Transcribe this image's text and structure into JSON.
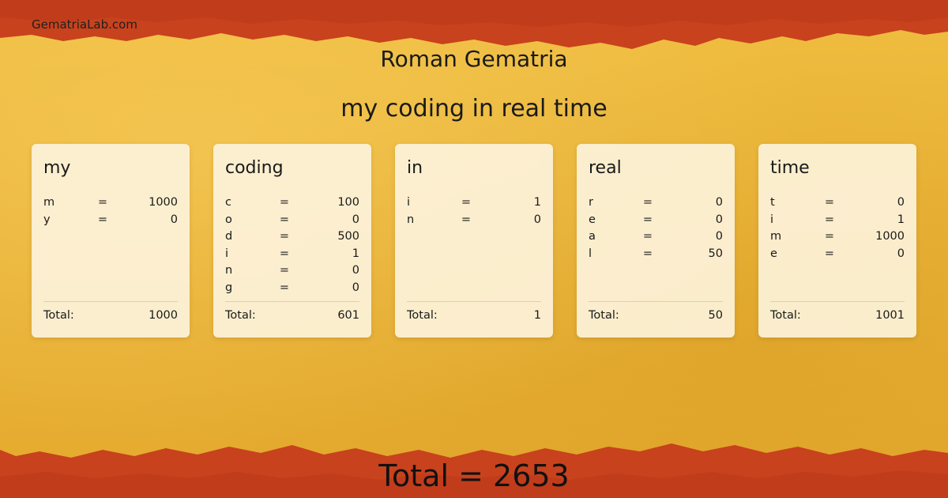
{
  "site": "GematriaLab.com",
  "title": "Roman Gematria",
  "phrase": "my coding in real time",
  "total_label": "Total:",
  "cards": [
    {
      "word": "my",
      "letters": [
        {
          "ch": "m",
          "eq": "=",
          "val": "1000"
        },
        {
          "ch": "y",
          "eq": "=",
          "val": "0"
        }
      ],
      "total": "1000"
    },
    {
      "word": "coding",
      "letters": [
        {
          "ch": "c",
          "eq": "=",
          "val": "100"
        },
        {
          "ch": "o",
          "eq": "=",
          "val": "0"
        },
        {
          "ch": "d",
          "eq": "=",
          "val": "500"
        },
        {
          "ch": "i",
          "eq": "=",
          "val": "1"
        },
        {
          "ch": "n",
          "eq": "=",
          "val": "0"
        },
        {
          "ch": "g",
          "eq": "=",
          "val": "0"
        }
      ],
      "total": "601"
    },
    {
      "word": "in",
      "letters": [
        {
          "ch": "i",
          "eq": "=",
          "val": "1"
        },
        {
          "ch": "n",
          "eq": "=",
          "val": "0"
        }
      ],
      "total": "1"
    },
    {
      "word": "real",
      "letters": [
        {
          "ch": "r",
          "eq": "=",
          "val": "0"
        },
        {
          "ch": "e",
          "eq": "=",
          "val": "0"
        },
        {
          "ch": "a",
          "eq": "=",
          "val": "0"
        },
        {
          "ch": "l",
          "eq": "=",
          "val": "50"
        }
      ],
      "total": "50"
    },
    {
      "word": "time",
      "letters": [
        {
          "ch": "t",
          "eq": "=",
          "val": "0"
        },
        {
          "ch": "i",
          "eq": "=",
          "val": "1"
        },
        {
          "ch": "m",
          "eq": "=",
          "val": "1000"
        },
        {
          "ch": "e",
          "eq": "=",
          "val": "0"
        }
      ],
      "total": "1001"
    }
  ],
  "grand_total": "Total = 2653",
  "colors": {
    "background": "#e9b236",
    "edge": "#c7421c",
    "card": "#fdf4de"
  }
}
